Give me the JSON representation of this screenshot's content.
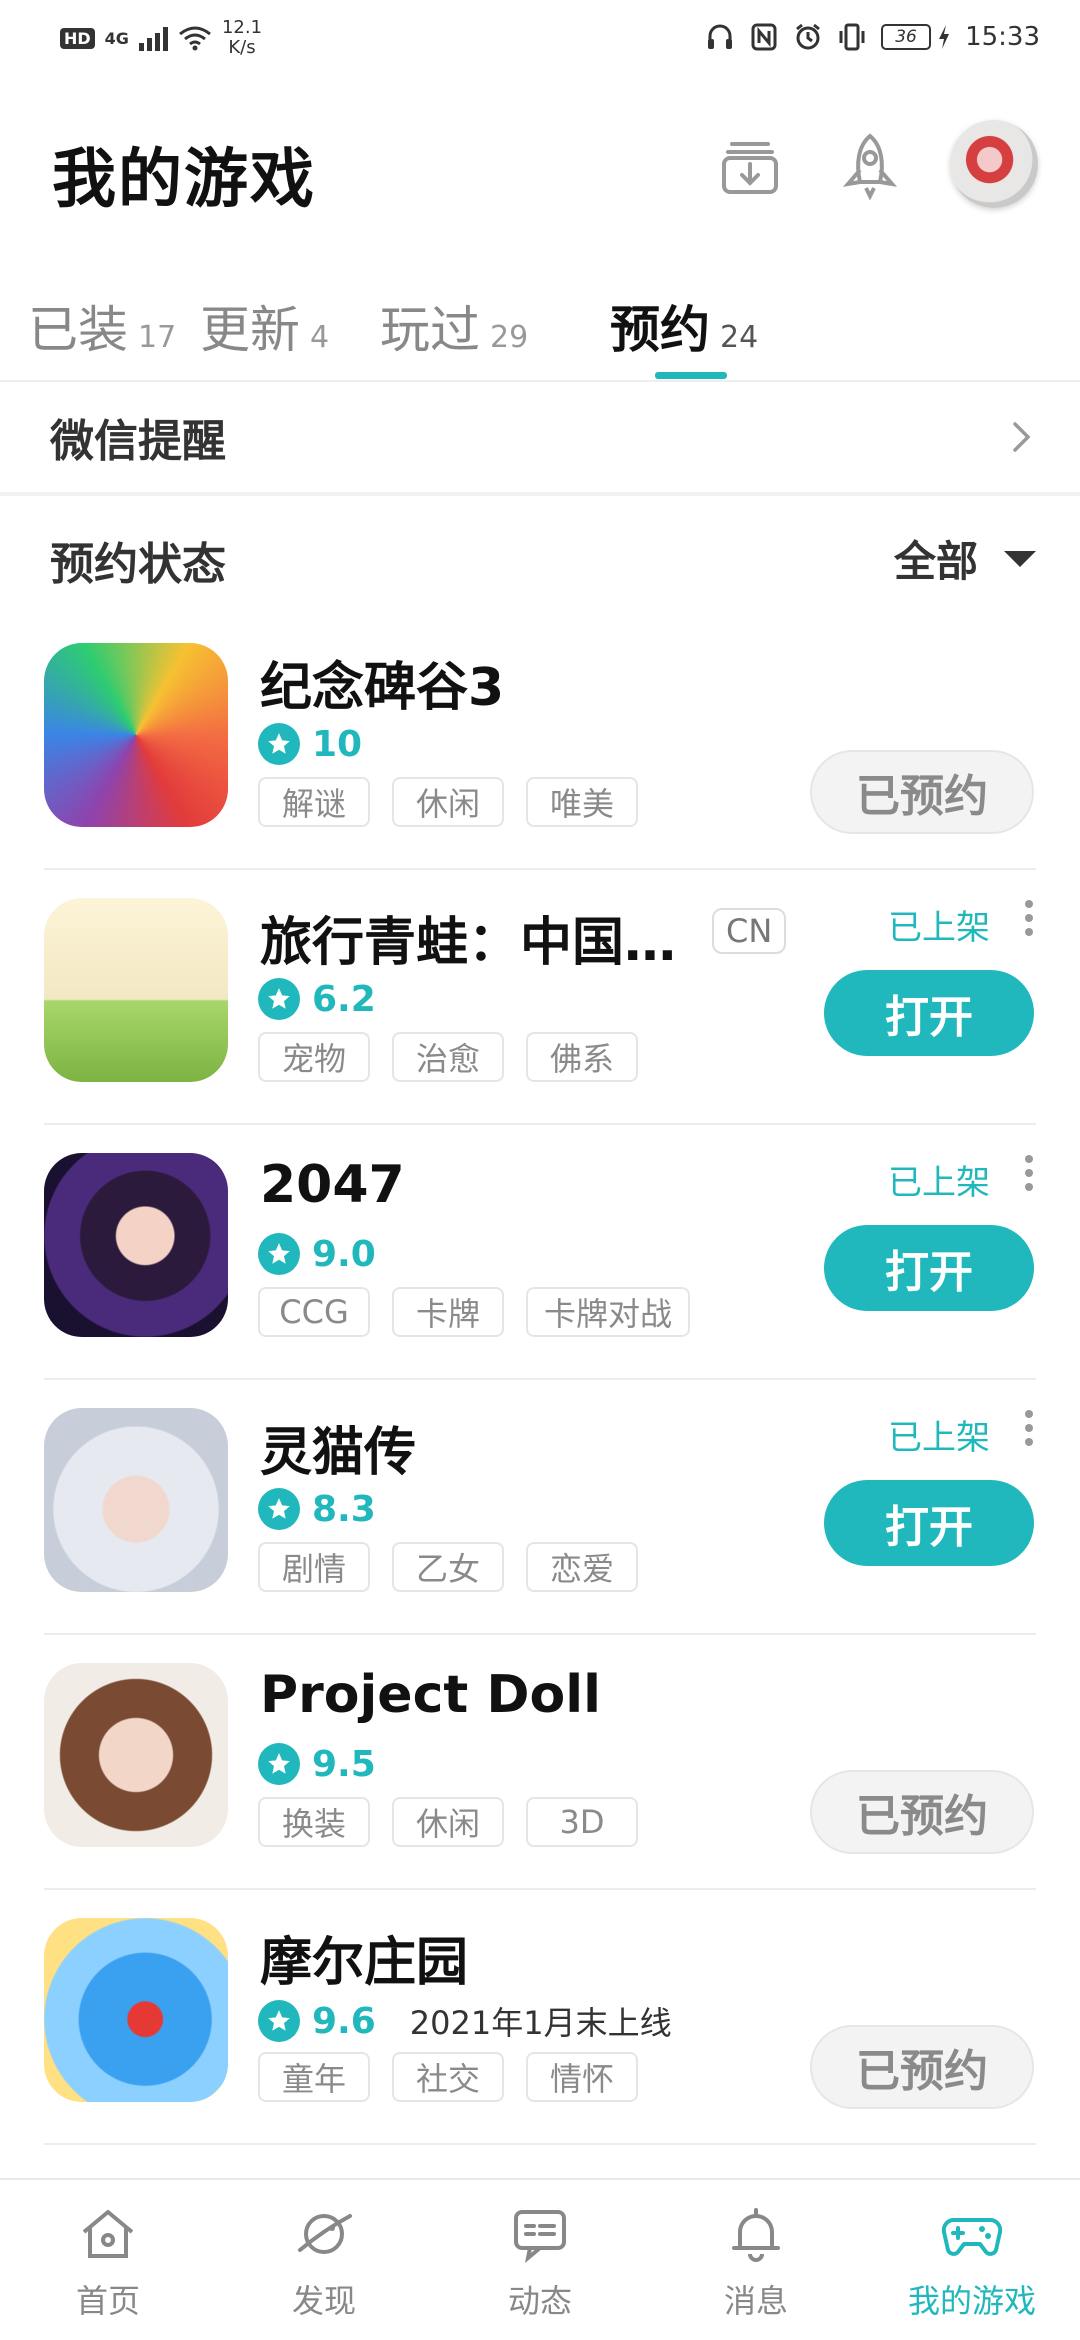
{
  "status_bar": {
    "hd": "HD",
    "signal": "4G",
    "net_speed_value": "12.1",
    "net_speed_unit": "K/s",
    "battery": "36",
    "time": "15:33"
  },
  "header": {
    "title": "我的游戏"
  },
  "tabs": [
    {
      "label": "已装",
      "count": "17"
    },
    {
      "label": "更新",
      "count": "4"
    },
    {
      "label": "玩过",
      "count": "29"
    },
    {
      "label": "预约",
      "count": "24"
    }
  ],
  "wechat_reminder": {
    "label": "微信提醒"
  },
  "filter": {
    "label": "预约状态",
    "selected": "全部"
  },
  "games": [
    {
      "name": "纪念碑谷3",
      "rating": "10",
      "tags": [
        "解谜",
        "休闲",
        "唯美"
      ],
      "button": "已预约"
    },
    {
      "name": "旅行青蛙：中国…",
      "region": "CN",
      "rating": "6.2",
      "tags": [
        "宠物",
        "治愈",
        "佛系"
      ],
      "status": "已上架",
      "button": "打开"
    },
    {
      "name": "2047",
      "rating": "9.0",
      "tags": [
        "CCG",
        "卡牌",
        "卡牌对战"
      ],
      "status": "已上架",
      "button": "打开"
    },
    {
      "name": "灵猫传",
      "rating": "8.3",
      "tags": [
        "剧情",
        "乙女",
        "恋爱"
      ],
      "status": "已上架",
      "button": "打开"
    },
    {
      "name": "Project Doll",
      "rating": "9.5",
      "tags": [
        "换装",
        "休闲",
        "3D"
      ],
      "button": "已预约"
    },
    {
      "name": "摩尔庄园",
      "rating": "9.6",
      "note": "2021年1月末上线",
      "tags": [
        "童年",
        "社交",
        "情怀"
      ],
      "button": "已预约"
    }
  ],
  "bottom_nav": [
    {
      "label": "首页",
      "icon": "home-icon"
    },
    {
      "label": "发现",
      "icon": "planet-icon"
    },
    {
      "label": "动态",
      "icon": "chat-icon"
    },
    {
      "label": "消息",
      "icon": "bell-icon"
    },
    {
      "label": "我的游戏",
      "icon": "gamepad-icon"
    }
  ],
  "colors": {
    "accent": "#21b8bd",
    "muted": "#8a8a8a"
  }
}
